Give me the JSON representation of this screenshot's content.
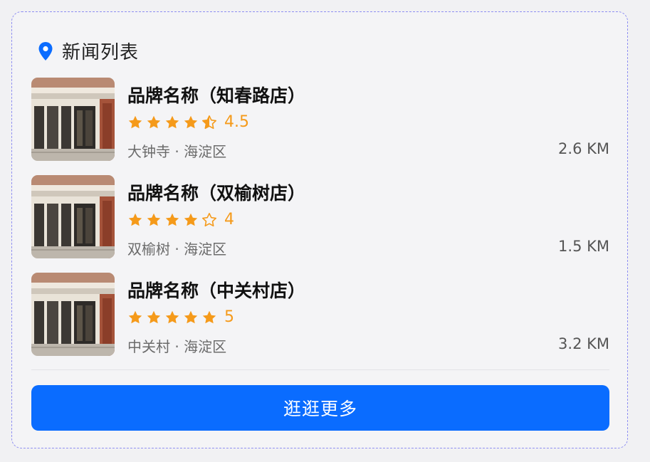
{
  "header": {
    "title": "新闻列表",
    "icon": "location-pin-icon",
    "icon_color": "#0a6cff"
  },
  "stores": [
    {
      "name": "品牌名称（知春路店）",
      "rating": 4.5,
      "rating_text": "4.5",
      "location": "大钟寺 · 海淀区",
      "distance": "2.6 KM",
      "image": "storefront-photo"
    },
    {
      "name": "品牌名称（双榆树店）",
      "rating": 4,
      "rating_text": "4",
      "location": "双榆树 · 海淀区",
      "distance": "1.5 KM",
      "image": "storefront-photo"
    },
    {
      "name": "品牌名称（中关村店）",
      "rating": 5,
      "rating_text": "5",
      "location": "中关村 · 海淀区",
      "distance": "3.2 KM",
      "image": "storefront-photo"
    }
  ],
  "more_button": {
    "label": "逛逛更多"
  },
  "colors": {
    "accent": "#0a6cff",
    "star": "#f59a1a"
  }
}
